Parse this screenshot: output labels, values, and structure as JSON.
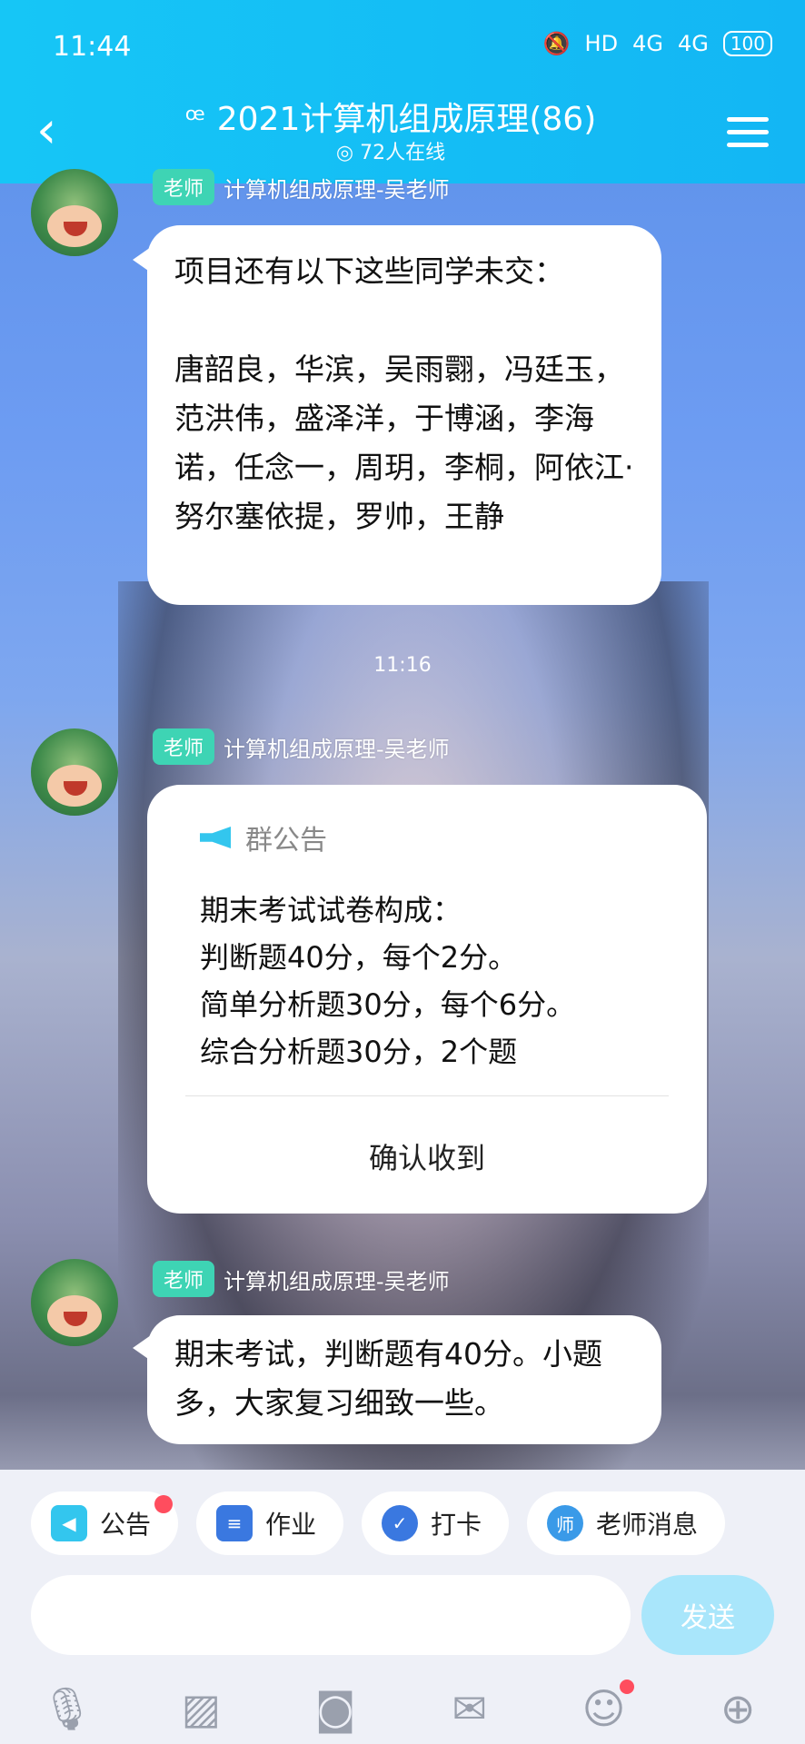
{
  "status_bar": {
    "time": "11:44",
    "network": "HD",
    "signal1": "4G",
    "signal2": "4G",
    "battery": "100"
  },
  "header": {
    "title": "2021计算机组成原理(86)",
    "online": "72人在线"
  },
  "messages": [
    {
      "badge": "老师",
      "sender": "计算机组成原理-吴老师",
      "text": "项目还有以下这些同学未交：\n\n唐韶良，华滨，吴雨翾，冯廷玉，范洪伟，盛泽洋，于博涵，李海诺，任念一，周玥，李桐，阿依江·努尔塞依提，罗帅，王静"
    },
    {
      "badge": "老师",
      "sender": "计算机组成原理-吴老师"
    },
    {
      "badge": "老师",
      "sender": "计算机组成原理-吴老师",
      "text": "期末考试，判断题有40分。小题多，大家复习细致一些。"
    }
  ],
  "time_divider": "11:16",
  "notice": {
    "title": "群公告",
    "body": "期末考试试卷构成：\n判断题40分，每个2分。\n简单分析题30分，每个6分。\n综合分析题30分，2个题",
    "confirm": "确认收到"
  },
  "quick_actions": [
    {
      "label": "公告",
      "icon": "megaphone-icon",
      "color": "#33c6ee",
      "dot": true
    },
    {
      "label": "作业",
      "icon": "document-icon",
      "color": "#3a78e0",
      "dot": false
    },
    {
      "label": "打卡",
      "icon": "check-icon",
      "color": "#3a78e0",
      "dot": false
    },
    {
      "label": "老师消息",
      "icon": "teacher-icon",
      "color": "#3a9ae8",
      "dot": false
    }
  ],
  "input": {
    "placeholder": "",
    "send": "发送"
  },
  "toolbar": [
    "microphone-icon",
    "image-icon",
    "camera-icon",
    "red-packet-icon",
    "emoji-icon",
    "plus-icon"
  ]
}
